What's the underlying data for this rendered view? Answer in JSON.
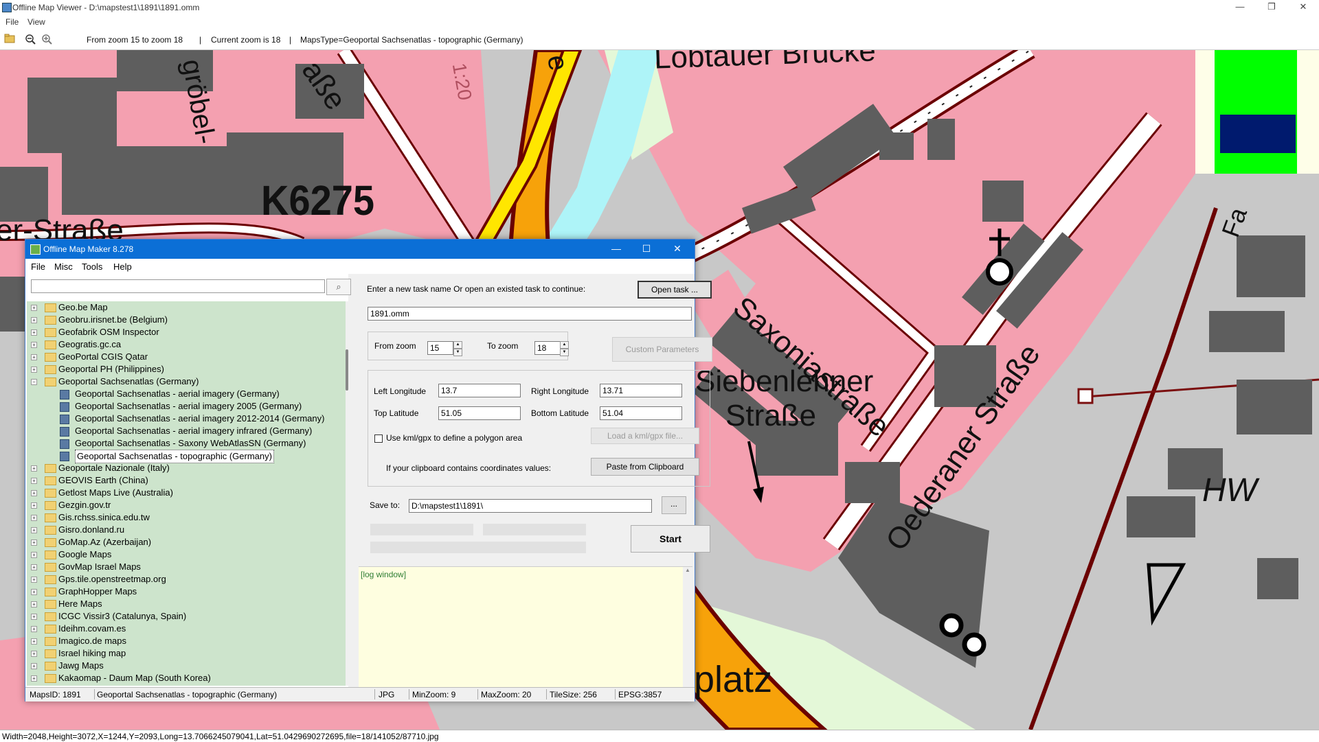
{
  "outer": {
    "title": "Offline Map Viewer - D:\\mapstest1\\1891\\1891.omm",
    "menu": [
      "File",
      "View"
    ],
    "toolbar": {
      "zoom_range": "From zoom 15 to zoom 18",
      "current_zoom": "Current zoom is 18",
      "maps_type": "MapsType=Geoportal Sachsenatlas - topographic (Germany)"
    },
    "status": "Width=2048,Height=3072,X=1244,Y=2093,Long=13.7066245079041,Lat=51.0429690272695,file=18/141052/87710.jpg"
  },
  "map_labels": {
    "street1": "Lobtauer Brücke",
    "road_code": "K6275",
    "street2": "Saxoniastraße",
    "street3": "Siebenlehner",
    "street3b": "Straße",
    "street4": "Oederaner Straße",
    "street5": "er-Straße",
    "street6": "aße",
    "street7": "gröbel-",
    "label_hw": "HW",
    "label_platz": "platz",
    "label_fa": "Fa",
    "label_scale": "1:20",
    "label_e": "e"
  },
  "dialog": {
    "title": "Offline Map Maker 8.278",
    "menu": [
      "File",
      "Misc",
      "Tools",
      "Help"
    ],
    "search": {
      "value": "",
      "placeholder": ""
    },
    "tree": [
      {
        "label": "Geo.be Map",
        "type": "folder"
      },
      {
        "label": "Geobru.irisnet.be (Belgium)",
        "type": "folder"
      },
      {
        "label": "Geofabrik OSM Inspector",
        "type": "folder"
      },
      {
        "label": "Geogratis.gc.ca",
        "type": "folder"
      },
      {
        "label": "GeoPortal CGIS Qatar",
        "type": "folder"
      },
      {
        "label": "Geoportal PH (Philippines)",
        "type": "folder"
      },
      {
        "label": "Geoportal Sachsenatlas (Germany)",
        "type": "folder-open"
      },
      {
        "label": "Geoportal Sachsenatlas - aerial imagery (Germany)",
        "type": "map"
      },
      {
        "label": "Geoportal Sachsenatlas - aerial imagery 2005 (Germany)",
        "type": "map"
      },
      {
        "label": "Geoportal Sachsenatlas - aerial imagery 2012-2014 (Germany)",
        "type": "map"
      },
      {
        "label": "Geoportal Sachsenatlas - aerial imagery infrared (Germany)",
        "type": "map"
      },
      {
        "label": "Geoportal Sachsenatlas - Saxony WebAtlasSN (Germany)",
        "type": "map"
      },
      {
        "label": "Geoportal Sachsenatlas - topographic (Germany)",
        "type": "map-selected"
      },
      {
        "label": "Geoportale Nazionale (Italy)",
        "type": "folder"
      },
      {
        "label": "GEOVIS Earth (China)",
        "type": "folder"
      },
      {
        "label": "Getlost Maps Live (Australia)",
        "type": "folder"
      },
      {
        "label": "Gezgin.gov.tr",
        "type": "folder"
      },
      {
        "label": "Gis.rchss.sinica.edu.tw",
        "type": "folder"
      },
      {
        "label": "Gisro.donland.ru",
        "type": "folder"
      },
      {
        "label": "GoMap.Az (Azerbaijan)",
        "type": "folder"
      },
      {
        "label": "Google Maps",
        "type": "folder"
      },
      {
        "label": "GovMap Israel Maps",
        "type": "folder"
      },
      {
        "label": "Gps.tile.openstreetmap.org",
        "type": "folder"
      },
      {
        "label": "GraphHopper Maps",
        "type": "folder"
      },
      {
        "label": "Here Maps",
        "type": "folder"
      },
      {
        "label": "ICGC Vissir3 (Catalunya, Spain)",
        "type": "folder"
      },
      {
        "label": "Ideihm.covam.es",
        "type": "folder"
      },
      {
        "label": "Imagico.de maps",
        "type": "folder"
      },
      {
        "label": "Israel hiking map",
        "type": "folder"
      },
      {
        "label": "Jawg Maps",
        "type": "folder"
      },
      {
        "label": "Kakaomap - Daum Map (South Korea)",
        "type": "folder"
      }
    ],
    "task_prompt": "Enter a new task name Or open an existed task to continue:",
    "open_task": "Open task ...",
    "task_name": "1891.omm",
    "from_zoom_label": "From zoom",
    "from_zoom": "15",
    "to_zoom_label": "To zoom",
    "to_zoom": "18",
    "custom_params": "Custom Parameters",
    "left_lon_label": "Left Longitude",
    "left_lon": "13.7",
    "right_lon_label": "Right Longitude",
    "right_lon": "13.71",
    "top_lat_label": "Top Latitude",
    "top_lat": "51.05",
    "bottom_lat_label": "Bottom Latitude",
    "bottom_lat": "51.04",
    "kml_label": "Use kml/gpx to define a polygon area",
    "load_kml": "Load a kml/gpx file...",
    "clipboard_label": "If your clipboard contains coordinates values:",
    "paste_clipboard": "Paste from Clipboard",
    "save_to_label": "Save to:",
    "save_to": "D:\\mapstest1\\1891\\",
    "browse": "...",
    "start": "Start",
    "log": "[log window]",
    "status": {
      "maps_id": "MapsID: 1891",
      "maps_name": "Geoportal Sachsenatlas - topographic (Germany)",
      "format": "JPG",
      "min_zoom": "MinZoom: 9",
      "max_zoom": "MaxZoom: 20",
      "tile_size": "TileSize: 256",
      "epsg": "EPSG:3857"
    }
  },
  "colors": {
    "map_pink": "#f4a0b0",
    "map_grey": "#c8c8c8",
    "building": "#5e5e5e",
    "road_orange": "#f7a20a",
    "road_yellow": "#ffe600",
    "water": "#aef4f8",
    "tree_bg": "#cde4cc",
    "title_blue": "#0b6fd6",
    "log_bg": "#fefee0"
  }
}
